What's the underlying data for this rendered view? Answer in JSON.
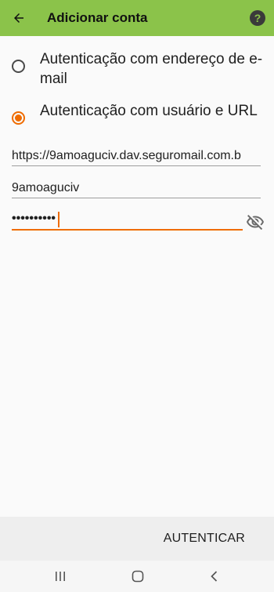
{
  "appbar": {
    "title": "Adicionar conta",
    "help_label": "?",
    "back_icon": "arrow-back-icon",
    "color": "#8bc34a"
  },
  "auth_options": [
    {
      "label": "Autenticação com endereço de e-mail",
      "selected": false
    },
    {
      "label": "Autenticação com usuário e URL",
      "selected": true
    }
  ],
  "fields": {
    "url_value": "https://9amoaguciv.dav.seguromail.com.b",
    "username_value": "9amoaguciv",
    "password_value": "••••••••••",
    "password_visibility_icon": "eye-off-icon"
  },
  "actions": {
    "authenticate_label": "AUTENTICAR"
  },
  "accent_color": "#ef6c00"
}
